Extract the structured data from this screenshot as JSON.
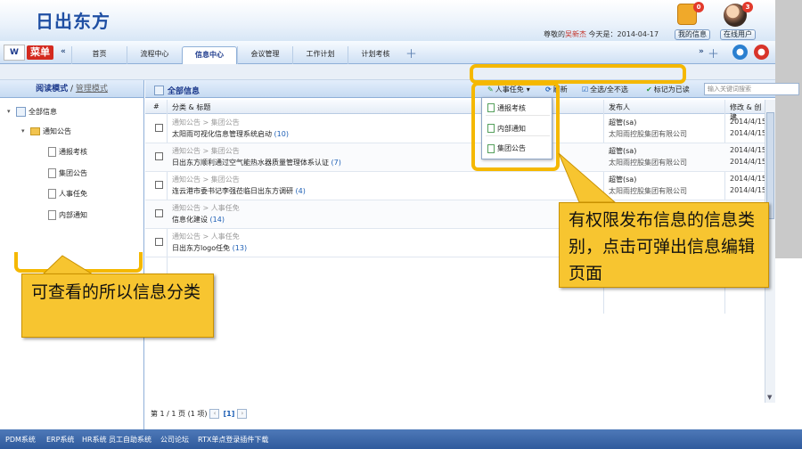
{
  "app": {
    "logo_text": "日出东方",
    "brand_logo": "W",
    "brand_menu": "菜单",
    "greeting_prefix": "尊敬的",
    "user_name": "吴新杰",
    "greeting_suffix": "今天是：2014-04-17",
    "my_messages": "我的信息",
    "online_users": "在线用户",
    "messages_badge": "0",
    "online_badge": "3"
  },
  "nav": {
    "tabs": [
      "首页",
      "流程中心",
      "信息中心",
      "会议管理",
      "工作计划",
      "计划考核"
    ],
    "active_index": 2
  },
  "left": {
    "mode_label": "阅读模式",
    "separator": "/",
    "manage_label": "管理模式",
    "root": "全部信息",
    "folder": "通知公告",
    "children": [
      "通报考核",
      "集团公告",
      "人事任免",
      "内部通知"
    ]
  },
  "main": {
    "title": "全部信息",
    "toolbar": {
      "publish_type": "人事任免",
      "refresh": "刷新",
      "select_all": "全选/全不选",
      "mark_read": "标记为已读",
      "search_placeholder": "输入关键词搜索"
    },
    "columns": [
      "#",
      "分类 & 标题",
      "发布人",
      "修改 & 创建"
    ],
    "rows": [
      {
        "category": "通知公告 > 集团公告",
        "title": "太阳雨可视化信息管理系统启动",
        "count": "(10)",
        "publisher": "超管(sa)",
        "org": "太阳雨控股集团有限公司",
        "modified": "2014/4/15",
        "created": "2014/4/15"
      },
      {
        "category": "通知公告 > 集团公告",
        "title": "日出东方顺利通过空气能热水器质量管理体系认证",
        "count": "(7)",
        "publisher": "超管(sa)",
        "org": "太阳雨控股集团有限公司",
        "modified": "2014/4/15",
        "created": "2014/4/15"
      },
      {
        "category": "通知公告 > 集团公告",
        "title": "连云港市委书记李强莅临日出东方调研",
        "count": "(4)",
        "publisher": "超管(sa)",
        "org": "太阳雨控股集团有限公司",
        "modified": "2014/4/15",
        "created": "2014/4/15"
      },
      {
        "category": "通知公告 > 人事任免",
        "title": "信息化建设",
        "count": "(14)",
        "publisher": "",
        "org": "",
        "modified": "",
        "created": ""
      },
      {
        "category": "通知公告 > 人事任免",
        "title": "日出东方logo任免",
        "count": "(13)",
        "publisher": "",
        "org": "",
        "modified": "",
        "created": ""
      }
    ],
    "pager": {
      "text": "第 1 / 1 页 (1 项)",
      "current": "[1]"
    }
  },
  "dropdown": {
    "items": [
      "通报考核",
      "内部通知",
      "集团公告"
    ]
  },
  "callouts": {
    "left": "可查看的所以信息分类",
    "right": "有权限发布信息的信息类别，点击可弹出信息编辑页面"
  },
  "footer": {
    "links": [
      "PDM系统",
      "ERP系统",
      "HR系统",
      "员工自助系统",
      "公司论坛",
      "RTX单点登录插件下载"
    ]
  },
  "colors": {
    "highlight": "#f5b800",
    "callout_bg": "#f7c530",
    "brand_red": "#d42a1f",
    "nav_blue": "#1d3a8c"
  }
}
